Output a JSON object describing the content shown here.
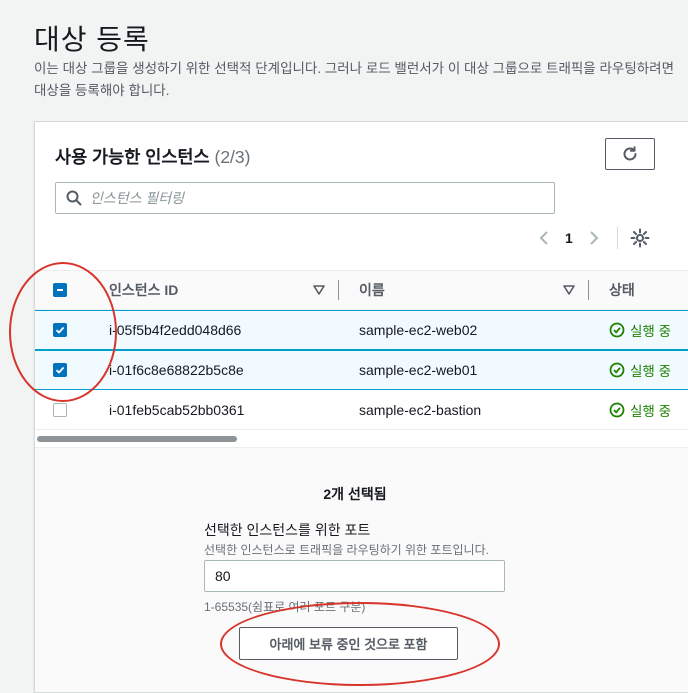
{
  "page": {
    "title": "대상 등록",
    "description": "이는 대상 그룹을 생성하기 위한 선택적 단계입니다. 그러나 로드 밸런서가 이 대상 그룹으로 트래픽을 라우팅하려면 대상을 등록해야 합니다."
  },
  "panel": {
    "title": "사용 가능한 인스턴스",
    "count": "(2/3)",
    "refresh_icon": "refresh-icon",
    "search": {
      "placeholder": "인스턴스 필터링",
      "value": ""
    },
    "pagination": {
      "current_page": "1"
    }
  },
  "table": {
    "columns": [
      "인스턴스 ID",
      "이름",
      "상태"
    ],
    "rows": [
      {
        "id": "i-05f5b4f2edd048d66",
        "name": "sample-ec2-web02",
        "state": "실행 중",
        "selected": true
      },
      {
        "id": "i-01f6c8e68822b5c8e",
        "name": "sample-ec2-web01",
        "state": "실행 중",
        "selected": true
      },
      {
        "id": "i-01feb5cab52bb0361",
        "name": "sample-ec2-bastion",
        "state": "실행 중",
        "selected": false
      }
    ]
  },
  "footer": {
    "selected_count": "2개 선택됨",
    "port_label": "선택한 인스턴스를 위한 포트",
    "port_help": "선택한 인스턴스로 트래픽을 라우팅하기 위한 포트입니다.",
    "port_value": "80",
    "port_constraint": "1-65535(쉼표로 여러 포트 구분)",
    "include_button": "아래에 보류 중인 것으로 포함"
  },
  "colors": {
    "accent": "#0073bb",
    "running": "#1d8102",
    "annotation": "#d7342b",
    "selected_row": "#f1faff"
  }
}
